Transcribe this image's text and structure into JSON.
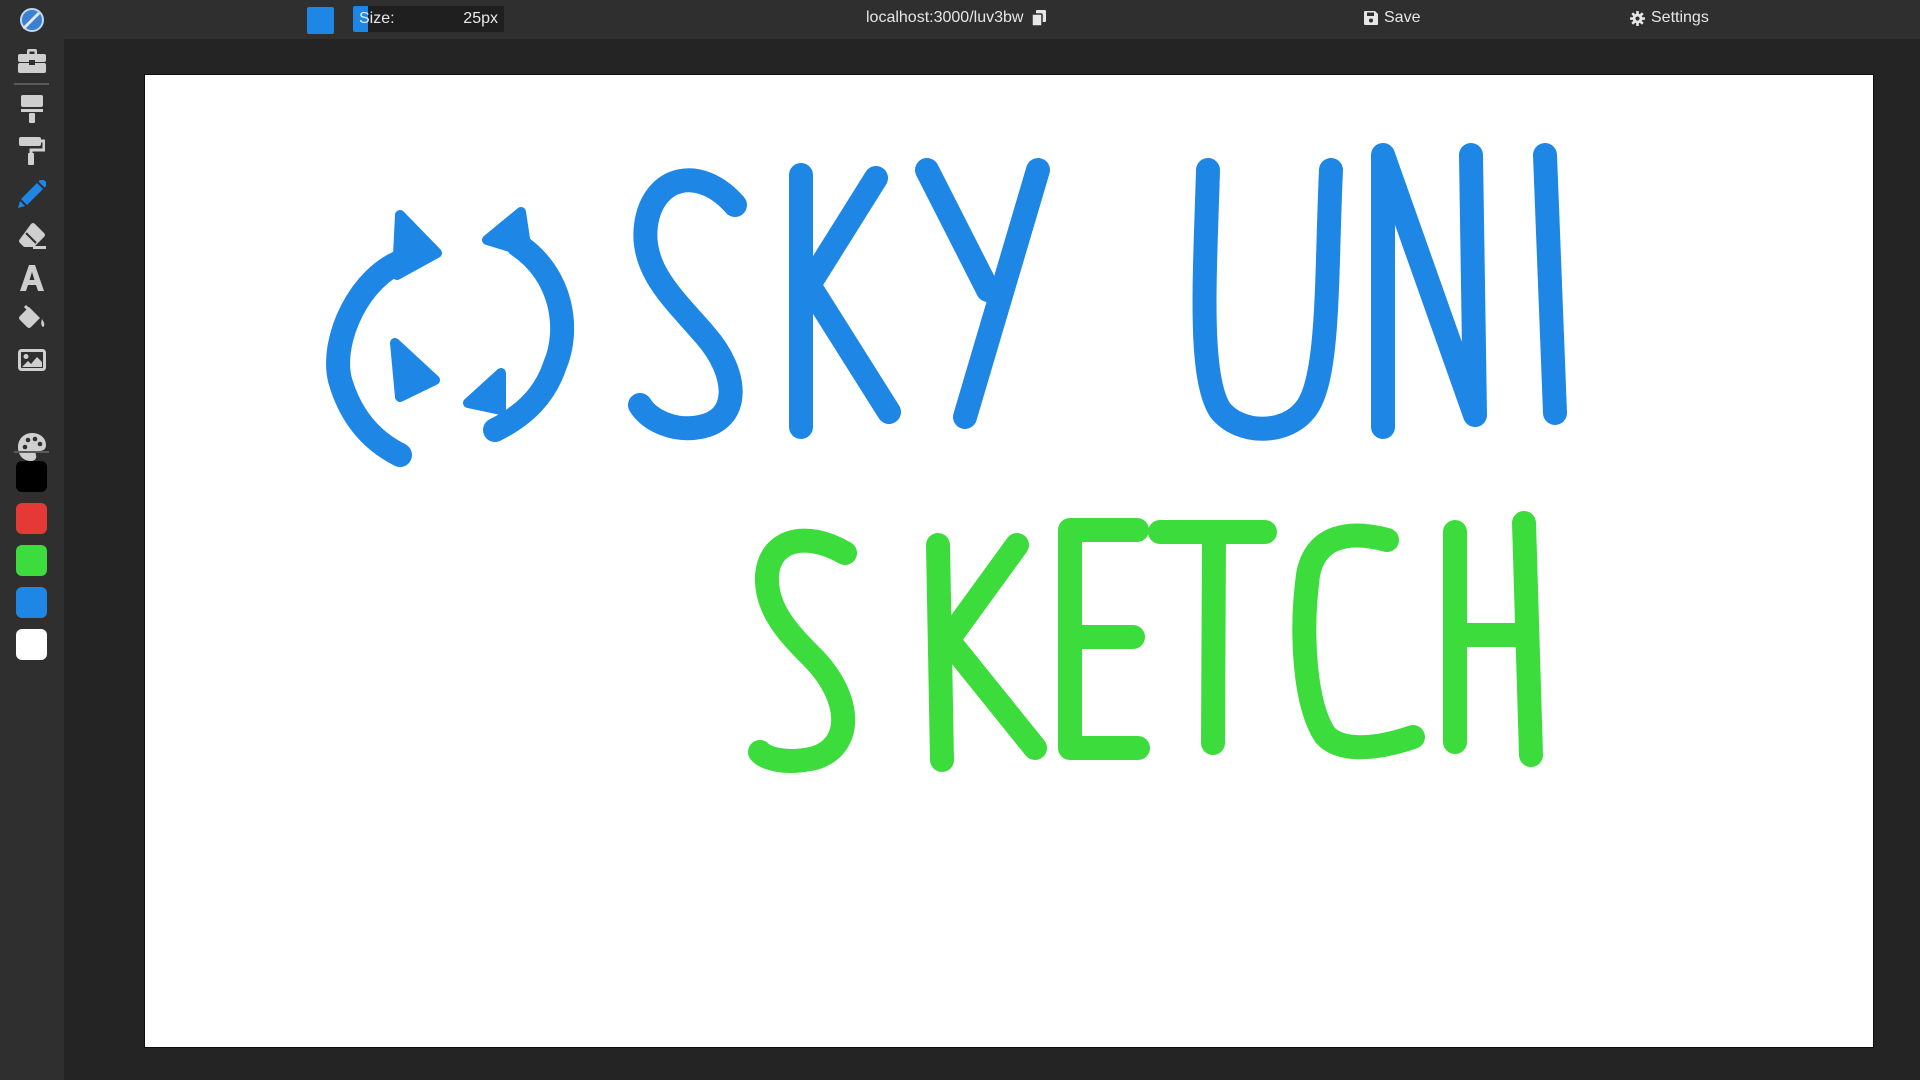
{
  "toolbar": {
    "current_color": "#1e87e5",
    "size_label": "Size:",
    "size_value": "25px",
    "size_fraction": 0.1,
    "share_url": "localhost:3000/luv3bw",
    "save_label": "Save",
    "settings_label": "Settings"
  },
  "sidebar": {
    "tools": [
      {
        "name": "toolbox-icon"
      },
      {
        "name": "paint-roller-icon"
      },
      {
        "name": "paint-brush-icon"
      },
      {
        "name": "pencil-icon",
        "active": true
      },
      {
        "name": "eraser-icon"
      },
      {
        "name": "text-icon"
      },
      {
        "name": "fill-bucket-icon"
      },
      {
        "name": "image-icon"
      },
      {
        "name": "palette-icon"
      }
    ],
    "swatches": [
      "#000000",
      "#e53935",
      "#3ddc3d",
      "#1e87e5",
      "#ffffff"
    ]
  },
  "canvas": {
    "text_line_1": "SKY UNI",
    "text_line_1_color": "#1e87e5",
    "text_line_2": "SKETCH",
    "text_line_2_color": "#3ddc3d"
  }
}
